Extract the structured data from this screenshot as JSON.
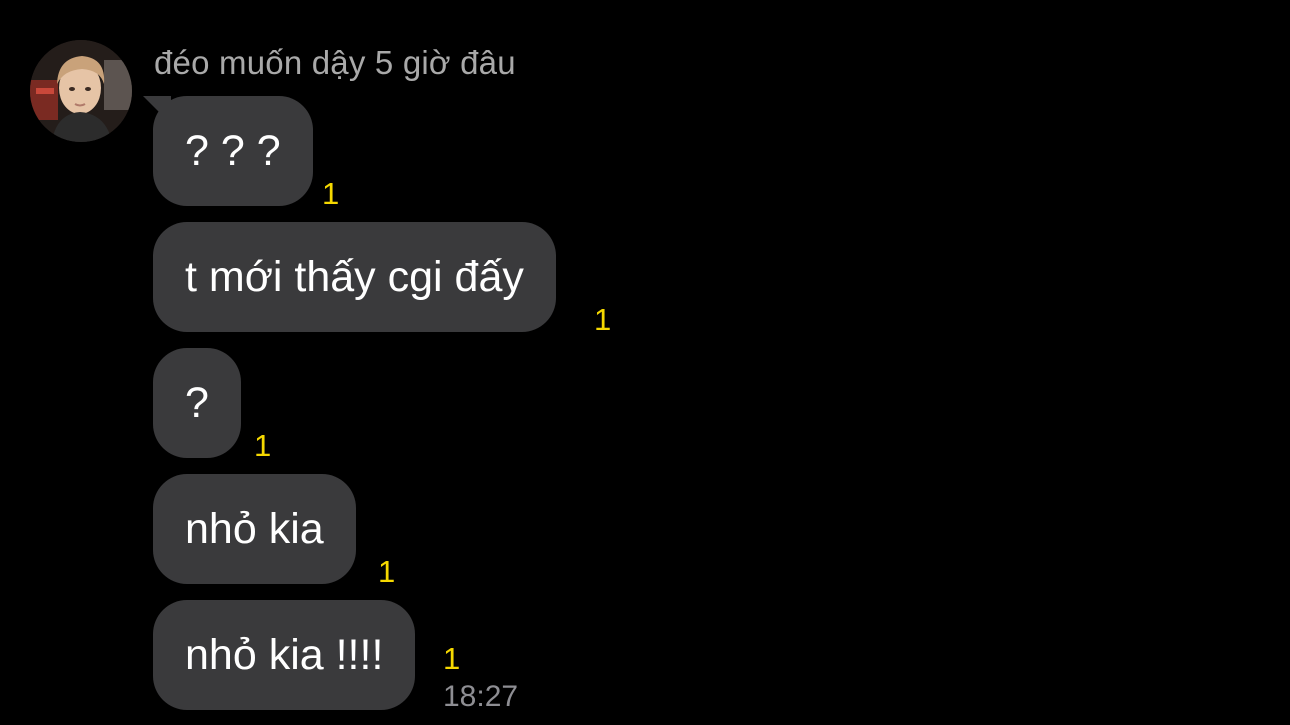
{
  "chat": {
    "sender_name": "đéo muốn dậy 5 giờ đâu",
    "unread_marker_color": "#f5d800",
    "messages": [
      {
        "text": "? ? ?",
        "unread": "1"
      },
      {
        "text": "t mới thấy cgi đấy",
        "unread": "1"
      },
      {
        "text": "?",
        "unread": "1"
      },
      {
        "text": "nhỏ kia",
        "unread": "1"
      },
      {
        "text": "nhỏ kia !!!!",
        "unread": "1",
        "time": "18:27"
      }
    ]
  }
}
